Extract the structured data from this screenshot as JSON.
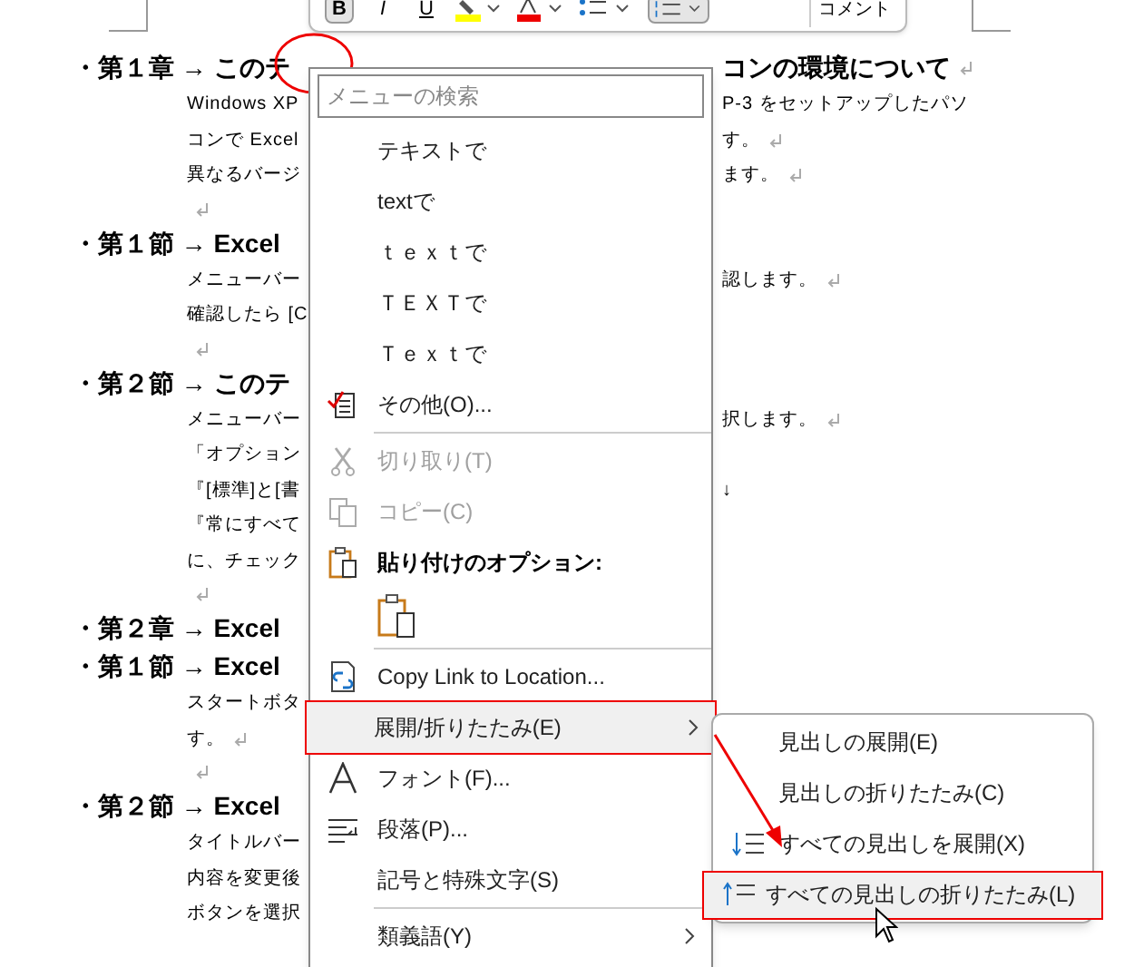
{
  "toolbar": {
    "buttons": [
      {
        "label": "B",
        "selected": true
      },
      {
        "label": "I",
        "selected": false
      },
      {
        "label": "U",
        "selected": false
      }
    ],
    "comment": "コメント"
  },
  "document": [
    {
      "kind": "heading",
      "left": "・第１章 → このテ",
      "right": "コンの環境について",
      "mark": true
    },
    {
      "kind": "body",
      "left": "Windows XP",
      "right": "P-3 をセットアップしたパソ",
      "mark": false
    },
    {
      "kind": "body",
      "left": "コンで Excel",
      "right": "す。",
      "mark": true
    },
    {
      "kind": "body",
      "left": "異なるバージ",
      "right": "ます。",
      "mark": true
    },
    {
      "kind": "blank",
      "mark": true
    },
    {
      "kind": "heading",
      "left": "・第１節 → Excel",
      "mark": false
    },
    {
      "kind": "body",
      "left": "メニューバー",
      "right": "認します。",
      "mark": true
    },
    {
      "kind": "body",
      "left": "確認したら [C",
      "mark": false
    },
    {
      "kind": "blank",
      "mark": true
    },
    {
      "kind": "heading",
      "left": "・第２節 → このテ",
      "mark": false
    },
    {
      "kind": "body",
      "left": "メニューバー",
      "right": "択します。",
      "mark": true
    },
    {
      "kind": "body",
      "left": "「オプション",
      "mark": false
    },
    {
      "kind": "body",
      "left": "『[標準]と[書",
      "right": "↓",
      "mark": false
    },
    {
      "kind": "body",
      "left": "『常にすべて",
      "mark": false
    },
    {
      "kind": "body",
      "left": "に、チェック",
      "mark": false
    },
    {
      "kind": "blank",
      "mark": true
    },
    {
      "kind": "heading",
      "left": "・第２章 → Excel",
      "mark": false
    },
    {
      "kind": "heading",
      "left": "・第１節 → Excel",
      "mark": false
    },
    {
      "kind": "body",
      "left": "スタートボタ",
      "mark": false
    },
    {
      "kind": "body",
      "left": "す。",
      "mark": true
    },
    {
      "kind": "blank",
      "mark": true
    },
    {
      "kind": "heading",
      "left": "・第２節 → Excel",
      "mark": false
    },
    {
      "kind": "body",
      "left": "タイトルバー",
      "mark": false
    },
    {
      "kind": "body",
      "left": "内容を変更後",
      "mark": false
    },
    {
      "kind": "body",
      "left": "ボタンを選択",
      "mark": false
    }
  ],
  "menu": {
    "search": {
      "placeholder": "メニューの検索"
    },
    "items": [
      {
        "kind": "item",
        "label": "テキストで",
        "disabled": false,
        "selected": false,
        "submenu": false
      },
      {
        "kind": "item",
        "label": "textで",
        "disabled": false,
        "selected": false,
        "submenu": false
      },
      {
        "kind": "item",
        "label": "ｔｅｘｔで",
        "disabled": false,
        "selected": false,
        "submenu": false
      },
      {
        "kind": "item",
        "label": "ＴＥＸＴで",
        "disabled": false,
        "selected": false,
        "submenu": false
      },
      {
        "kind": "item",
        "label": "Ｔｅｘｔで",
        "disabled": false,
        "selected": false,
        "submenu": false
      },
      {
        "kind": "item",
        "label": "その他(O)...",
        "disabled": false,
        "selected": false,
        "submenu": false
      },
      {
        "kind": "separator"
      },
      {
        "kind": "item",
        "label": "切り取り(T)",
        "disabled": true,
        "selected": false,
        "submenu": false
      },
      {
        "kind": "item",
        "label": "コピー(C)",
        "disabled": true,
        "selected": false,
        "submenu": false
      },
      {
        "kind": "header",
        "label": "貼り付けのオプション:"
      },
      {
        "kind": "paste"
      },
      {
        "kind": "separator"
      },
      {
        "kind": "item",
        "label": "Copy Link to Location...",
        "disabled": false,
        "selected": false,
        "submenu": false
      },
      {
        "kind": "item",
        "label": "展開/折りたたみ(E)",
        "disabled": false,
        "selected": true,
        "submenu": true
      },
      {
        "kind": "item",
        "label": "フォント(F)...",
        "disabled": false,
        "selected": false,
        "submenu": false
      },
      {
        "kind": "item",
        "label": "段落(P)...",
        "disabled": false,
        "selected": false,
        "submenu": false
      },
      {
        "kind": "item",
        "label": "記号と特殊文字(S)",
        "disabled": false,
        "selected": false,
        "submenu": false
      },
      {
        "kind": "separator"
      },
      {
        "kind": "item",
        "label": "類義語(Y)",
        "disabled": false,
        "selected": false,
        "submenu": true
      }
    ]
  },
  "submenu": {
    "items": [
      {
        "label": "見出しの展開(E)",
        "selected": false
      },
      {
        "label": "見出しの折りたたみ(C)",
        "selected": false
      },
      {
        "label": "すべての見出しを展開(X)",
        "selected": false
      },
      {
        "label": "すべての見出しの折りたたみ(L)",
        "selected": true
      }
    ]
  }
}
